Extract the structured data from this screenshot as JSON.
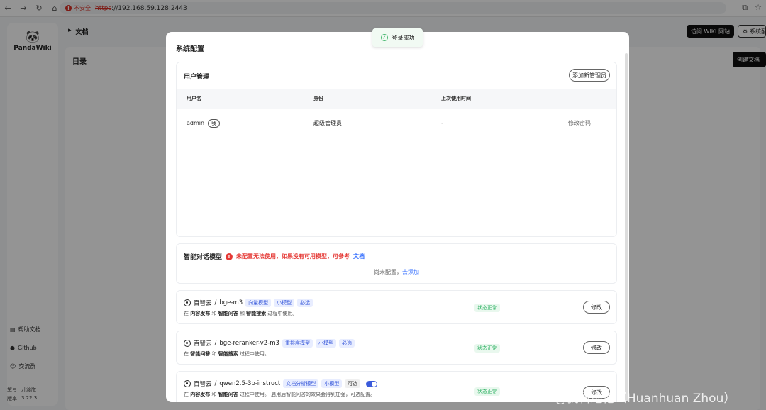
{
  "browser": {
    "insecure_label": "不安全",
    "url_scheme": "https",
    "url_rest": "://192.168.59.128:2443"
  },
  "sidebar": {
    "app_name": "PandaWiki",
    "links": [
      {
        "label": "帮助文档",
        "icon": "document-icon"
      },
      {
        "label": "Github",
        "icon": "github-icon"
      },
      {
        "label": "交流群",
        "icon": "group-icon"
      }
    ],
    "model_label": "型号",
    "edition": "开源版",
    "version_label": "版本",
    "version": "3.22.3"
  },
  "header": {
    "breadcrumb": "文档",
    "visit_wiki": "访问 WIKI 网站",
    "system_config": "系统配"
  },
  "main": {
    "toc": "目录",
    "create_doc": "创建文档"
  },
  "toast": {
    "text": "登录成功"
  },
  "modal": {
    "title": "系统配置",
    "users": {
      "title": "用户管理",
      "add_button": "添加新管理员",
      "columns": [
        "用户名",
        "身份",
        "上次使用时间",
        ""
      ],
      "rows": [
        {
          "username": "admin",
          "badge": "我",
          "role": "超级管理员",
          "last_used": "-",
          "action": "修改密码"
        }
      ]
    },
    "chat_model": {
      "title": "智能对话模型",
      "error": "未配置无法使用，如果没有可用模型，可参考",
      "doc_link": "文档",
      "empty": "尚未配置，",
      "add_link": "去添加"
    },
    "models": [
      {
        "provider": "百智云",
        "name": "bge-m3",
        "tags": [
          "向量模型",
          "小模型",
          "必选"
        ],
        "desc_pre": "在",
        "desc_b1": "内容发布",
        "desc_mid": "和",
        "desc_b2": "智能问答",
        "desc_mid2": "和",
        "desc_b3": "智能搜索",
        "desc_post": "过程中使用。",
        "status": "状态正常",
        "edit": "修改"
      },
      {
        "provider": "百智云",
        "name": "bge-reranker-v2-m3",
        "tags": [
          "重排序模型",
          "小模型",
          "必选"
        ],
        "desc_pre": "在",
        "desc_b1": "智能问答",
        "desc_mid": "和",
        "desc_b2": "智能搜索",
        "desc_post": "过程中使用。",
        "status": "状态正常",
        "edit": "修改"
      },
      {
        "provider": "百智云",
        "name": "qwen2.5-3b-instruct",
        "tags": [
          "文档分析模型",
          "小模型"
        ],
        "optional": "可选",
        "desc_pre": "在",
        "desc_b1": "内容发布",
        "desc_mid": "和",
        "desc_b2": "智能问答",
        "desc_post": "过程中使用。 启用后智能问答的效果会得到加强，可选配置。",
        "status": "状态正常",
        "edit": "修改"
      }
    ]
  },
  "watermark": "CSDN @我科绝伦（Huanhuan Zhou）",
  "colors": {
    "accent": "#3b5bdb",
    "error": "#e53935",
    "success": "#37b56a"
  }
}
